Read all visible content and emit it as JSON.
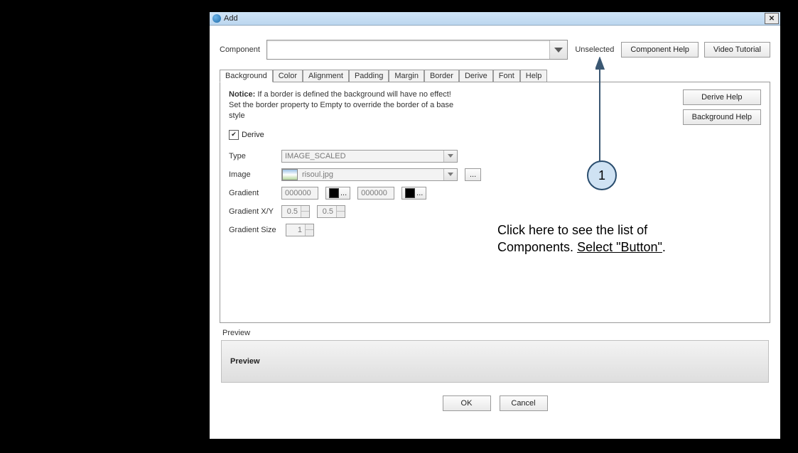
{
  "window": {
    "title": "Add",
    "close": "✕"
  },
  "top": {
    "component_label": "Component",
    "component_value": "",
    "unselected": "Unselected",
    "component_help": "Component Help",
    "video_tutorial": "Video Tutorial"
  },
  "tabs": [
    "Background",
    "Color",
    "Alignment",
    "Padding",
    "Margin",
    "Border",
    "Derive",
    "Font",
    "Help"
  ],
  "panel": {
    "notice_label": "Notice:",
    "notice_text": " If a border is defined the background will have no effect! Set the border property to Empty to override the border of a base style",
    "derive_check_label": "Derive",
    "derive_checked": true,
    "type_label": "Type",
    "type_value": "IMAGE_SCALED",
    "image_label": "Image",
    "image_value": "risoul.jpg",
    "image_more": "...",
    "gradient_label": "Gradient",
    "gradient_a": "000000",
    "gradient_a_more": "...",
    "gradient_b": "000000",
    "gradient_b_more": "...",
    "gradient_xy_label": "Gradient X/Y",
    "gradient_x": "0.5",
    "gradient_y": "0.5",
    "gradient_size_label": "Gradient Size",
    "gradient_size": "1",
    "derive_help": "Derive Help",
    "background_help": "Background Help"
  },
  "preview": {
    "label": "Preview",
    "content": "Preview"
  },
  "buttons": {
    "ok": "OK",
    "cancel": "Cancel"
  },
  "annotation": {
    "number": "1",
    "line1": "Click here to see the list of",
    "line2_a": "Components. ",
    "line2_b": "Select \"Button\"",
    "line2_c": "."
  }
}
